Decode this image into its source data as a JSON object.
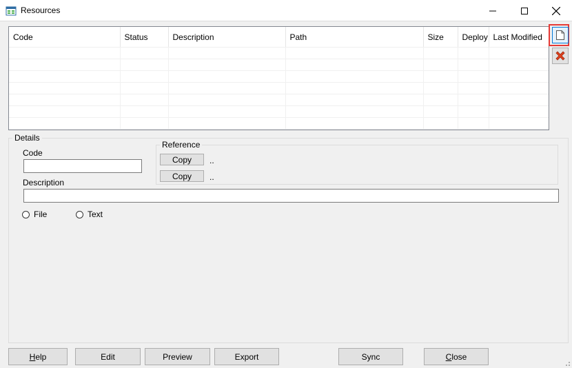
{
  "window": {
    "title": "Resources",
    "minimize_icon": "minimize-icon",
    "maximize_icon": "maximize-icon",
    "close_icon": "close-icon"
  },
  "grid": {
    "columns": [
      "Code",
      "Status",
      "Description",
      "Path",
      "Size",
      "Deploy",
      "Last Modified"
    ],
    "rows": []
  },
  "toolbar": {
    "new_icon": "new-document-icon",
    "delete_icon": "delete-x-icon"
  },
  "details": {
    "group_label": "Details",
    "code_label": "Code",
    "code_value": "",
    "description_label": "Description",
    "description_value": "",
    "reference": {
      "group_label": "Reference",
      "copy1_label": "Copy",
      "copy1_value": "..",
      "copy2_label": "Copy",
      "copy2_value": ".."
    },
    "radio_file_label": "File",
    "radio_text_label": "Text"
  },
  "buttons": {
    "help": {
      "first": "H",
      "rest": "elp"
    },
    "edit": "Edit",
    "preview": "Preview",
    "export": "Export",
    "sync": "Sync",
    "close": {
      "first": "C",
      "rest": "lose"
    }
  },
  "colors": {
    "window_bg": "#f0f0f0",
    "accent": "#0078d7",
    "highlight": "#e53935",
    "delete_red": "#d9534f"
  }
}
